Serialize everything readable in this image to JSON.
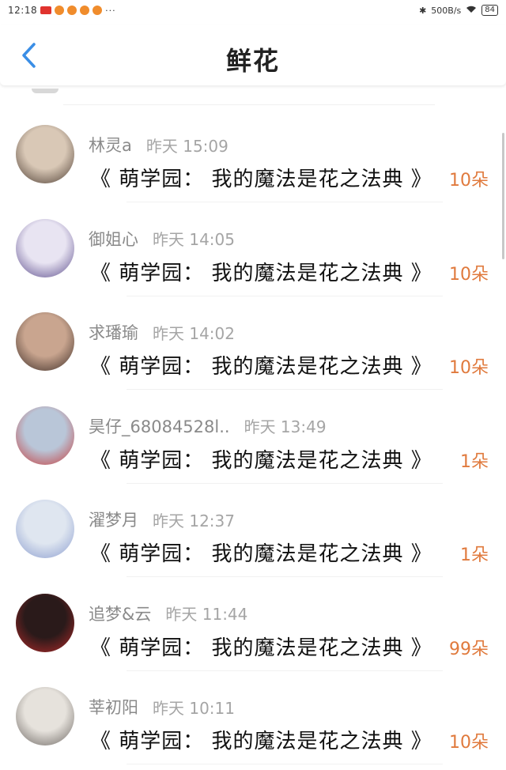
{
  "status_bar": {
    "time": "12:18",
    "dots": "···",
    "network_speed": "500B/s",
    "battery": "84"
  },
  "header": {
    "title": "鲜花"
  },
  "colors": {
    "accent_blue": "#3a8ee6",
    "amount_orange": "#e07a3d"
  },
  "entries": [
    {
      "name": "林灵a",
      "time": "昨天 15:09",
      "book": "《 萌学园： 我的魔法是花之法典 》",
      "amount": "10朵",
      "avatar_colors": [
        "#d9c8b6",
        "#4a3a30"
      ]
    },
    {
      "name": "御姐心",
      "time": "昨天 14:05",
      "book": "《 萌学园： 我的魔法是花之法典 》",
      "amount": "10朵",
      "avatar_colors": [
        "#e8e4f2",
        "#5a4a8a"
      ]
    },
    {
      "name": "求璠瑜",
      "time": "昨天 14:02",
      "book": "《 萌学园： 我的魔法是花之法典 》",
      "amount": "10朵",
      "avatar_colors": [
        "#c9a58f",
        "#3a2a24"
      ]
    },
    {
      "name": "昊仔_68084528l..",
      "time": "昨天 13:49",
      "book": "《 萌学园： 我的魔法是花之法典 》",
      "amount": "1朵",
      "avatar_colors": [
        "#b9c6d8",
        "#c63a3a"
      ]
    },
    {
      "name": "濯梦月",
      "time": "昨天 12:37",
      "book": "《 萌学园： 我的魔法是花之法典 》",
      "amount": "1朵",
      "avatar_colors": [
        "#dfe6f0",
        "#8a9ccf"
      ]
    },
    {
      "name": "追梦&云",
      "time": "昨天 11:44",
      "book": "《 萌学园： 我的魔法是花之法典 》",
      "amount": "99朵",
      "avatar_colors": [
        "#2a1a1a",
        "#b52a2a"
      ]
    },
    {
      "name": "莘初阳",
      "time": "昨天 10:11",
      "book": "《 萌学园： 我的魔法是花之法典 》",
      "amount": "10朵",
      "avatar_colors": [
        "#e6e2dc",
        "#6a6460"
      ]
    }
  ]
}
